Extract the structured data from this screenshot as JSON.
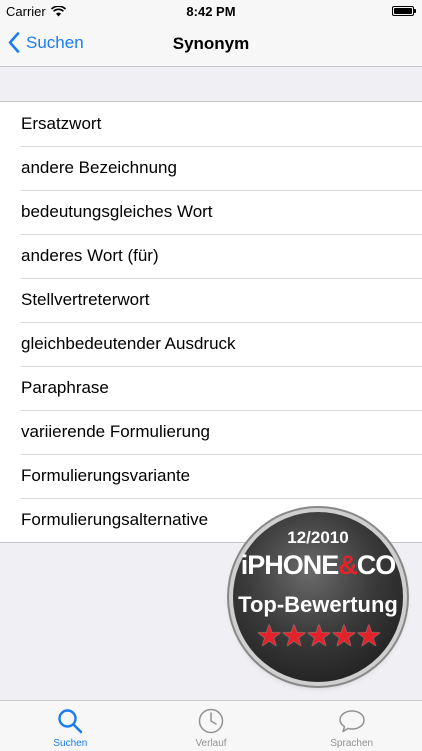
{
  "status_bar": {
    "carrier": "Carrier",
    "time": "8:42 PM",
    "battery_level": 1.0
  },
  "nav": {
    "back_label": "Suchen",
    "title": "Synonym"
  },
  "synonyms": [
    "Ersatzwort",
    "andere Bezeichnung",
    "bedeutungsgleiches Wort",
    "anderes Wort (für)",
    "Stellvertreterwort",
    "gleichbedeutender Ausdruck",
    "Paraphrase",
    "variierende Formulierung",
    "Formulierungsvariante",
    "Formulierungsalternative"
  ],
  "badge": {
    "year": "12/2010",
    "brand_part1": "iPHONE",
    "brand_amp": "&",
    "brand_part2": "CO",
    "rating_label": "Top-Bewertung",
    "stars": 5
  },
  "tabs": [
    {
      "label": "Suchen",
      "icon": "search-icon",
      "active": true
    },
    {
      "label": "Verlauf",
      "icon": "clock-icon",
      "active": false
    },
    {
      "label": "Sprachen",
      "icon": "speech-bubble-icon",
      "active": false
    }
  ],
  "colors": {
    "accent": "#1a7cf3",
    "badge_red": "#e3232b",
    "background": "#efeff4"
  }
}
